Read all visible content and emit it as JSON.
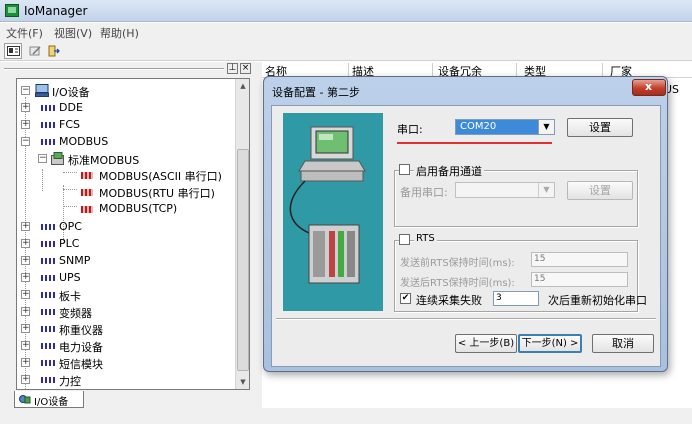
{
  "app": {
    "title": "IoManager"
  },
  "menu": [
    "文件(F)",
    "视图(V)",
    "帮助(H)"
  ],
  "tree": {
    "root": "I/O设备",
    "items": [
      {
        "label": "DDE",
        "expander": "+"
      },
      {
        "label": "FCS",
        "expander": "+"
      },
      {
        "label": "MODBUS",
        "expander": "-"
      },
      {
        "label": "标准MODBUS",
        "expander": "-"
      },
      {
        "label": "MODBUS(ASCII 串行口)"
      },
      {
        "label": "MODBUS(RTU 串行口)"
      },
      {
        "label": "MODBUS(TCP)"
      },
      {
        "label": "OPC",
        "expander": "+"
      },
      {
        "label": "PLC",
        "expander": "+"
      },
      {
        "label": "SNMP",
        "expander": "+"
      },
      {
        "label": "UPS",
        "expander": "+"
      },
      {
        "label": "板卡",
        "expander": "+"
      },
      {
        "label": "变频器",
        "expander": "+"
      },
      {
        "label": "称重仪器",
        "expander": "+"
      },
      {
        "label": "电力设备",
        "expander": "+"
      },
      {
        "label": "短信模块",
        "expander": "+"
      },
      {
        "label": "力控",
        "expander": "+"
      }
    ],
    "bottom_tab": "I/O设备"
  },
  "list": {
    "columns": [
      "名称",
      "描述",
      "设备冗余",
      "类型",
      "厂家"
    ],
    "row_tail": "US"
  },
  "dialog": {
    "title": "设备配置 - 第二步",
    "serial_label": "串口:",
    "serial_value": "COM20",
    "settings_button": "设置",
    "backup_group_label": "启用备用通道",
    "backup_serial_label": "备用串口:",
    "backup_settings_button": "设置",
    "rts_group_label": "RTS",
    "rts_before_label": "发送前RTS保持时间(ms):",
    "rts_before_value": "15",
    "rts_after_label": "发送后RTS保持时间(ms):",
    "rts_after_value": "15",
    "fail_checkbox_label": "连续采集失败",
    "fail_count": "3",
    "fail_suffix": "次后重新初始化串口",
    "back_button": "< 上一步(B)",
    "next_button": "下一步(N) >",
    "cancel_button": "取消"
  }
}
